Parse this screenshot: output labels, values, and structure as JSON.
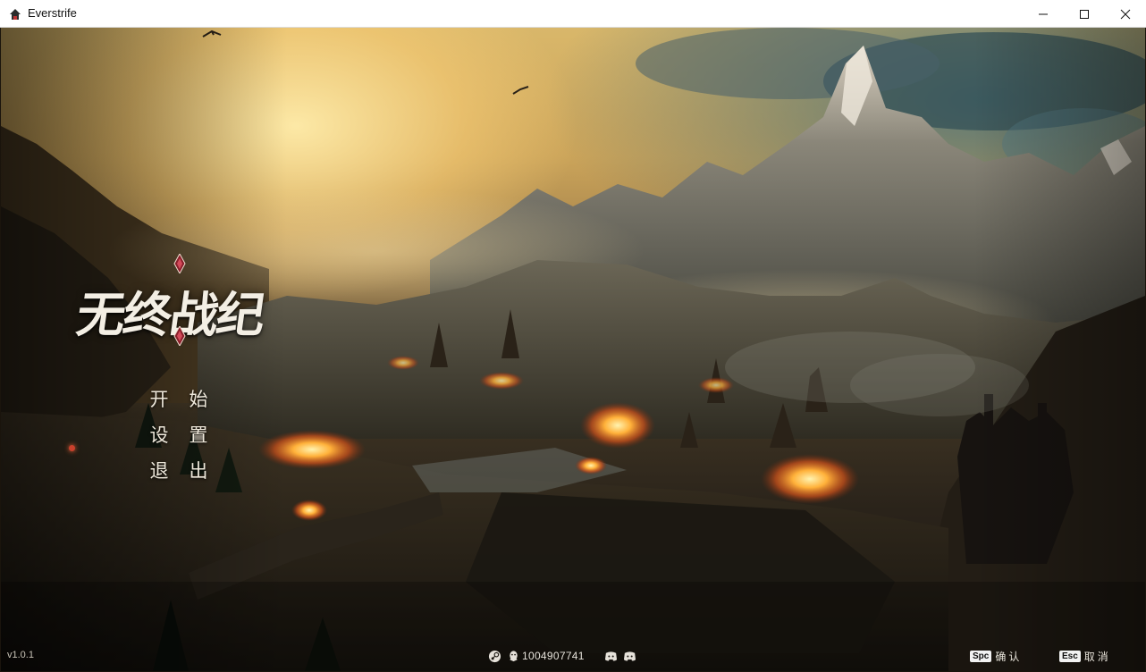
{
  "window": {
    "title": "Everstrife",
    "icon": "game-app-icon",
    "controls": [
      "minimize-icon",
      "maximize-icon",
      "close-icon"
    ]
  },
  "game": {
    "logo_title": "无终战纪",
    "menu": [
      {
        "id": "start",
        "chars": [
          "开",
          "始"
        ]
      },
      {
        "id": "settings",
        "chars": [
          "设",
          "置"
        ]
      },
      {
        "id": "quit",
        "chars": [
          "退",
          "出"
        ]
      }
    ],
    "version": "v1.0.1",
    "footer": {
      "icons": [
        "steam-icon",
        "qq-icon",
        "discord-icon",
        "discord-icon"
      ],
      "qq_number": "1004907741"
    },
    "hints": {
      "confirm_key": "Spc",
      "confirm_label": "确认",
      "cancel_key": "Esc",
      "cancel_label": "取消"
    }
  }
}
